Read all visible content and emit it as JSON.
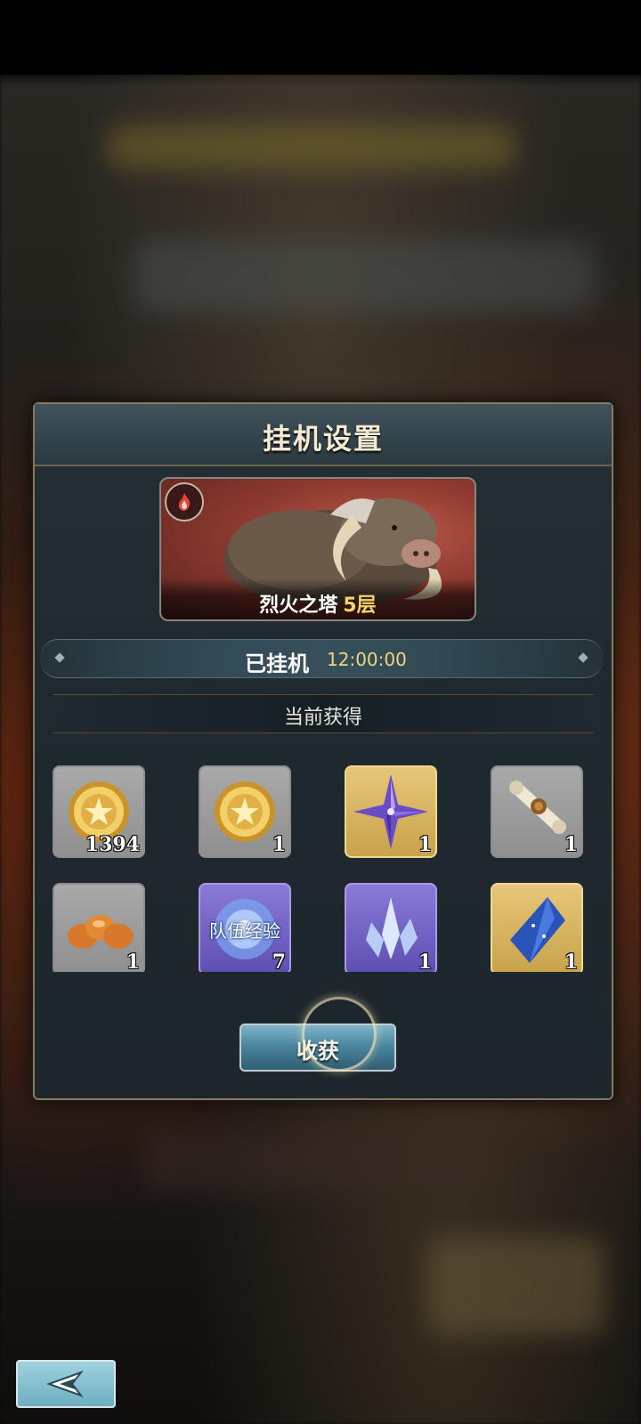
{
  "dialog": {
    "title": "挂机设置"
  },
  "stage": {
    "name": "烈火之塔",
    "floor": "5层",
    "element_icon": "fire-icon"
  },
  "status": {
    "label": "已挂机",
    "time": "12:00:00"
  },
  "earnings": {
    "header": "当前获得",
    "items": [
      {
        "icon": "gold-coin-icon",
        "count": "1394",
        "rarity": "gray"
      },
      {
        "icon": "gold-coin-icon",
        "count": "1",
        "rarity": "gray"
      },
      {
        "icon": "purple-star-crystal-icon",
        "count": "1",
        "rarity": "gold"
      },
      {
        "icon": "scroll-icon",
        "count": "1",
        "rarity": "gray"
      },
      {
        "icon": "bread-icon",
        "count": "1",
        "rarity": "gray"
      },
      {
        "icon": "team-exp-icon",
        "label": "队伍经验",
        "count": "7",
        "rarity": "purple"
      },
      {
        "icon": "ice-crystal-icon",
        "count": "1",
        "rarity": "purple"
      },
      {
        "icon": "blue-gem-icon",
        "count": "1",
        "rarity": "gold"
      }
    ]
  },
  "actions": {
    "harvest_label": "收获",
    "back_icon": "back-arrow-icon"
  },
  "colors": {
    "accent_gold": "#f3d36a",
    "panel_bg": "#1f2a30",
    "button_blue": "#4b87a0"
  }
}
